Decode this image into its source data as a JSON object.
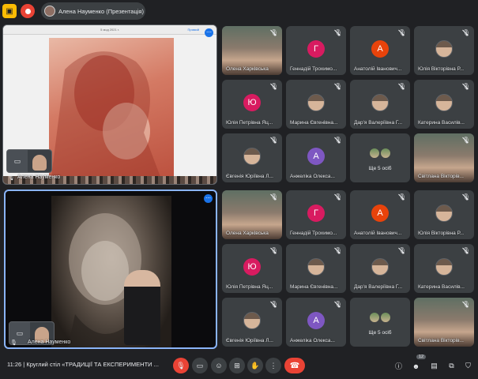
{
  "topbar": {
    "presenter_label": "Алена Науменко (Презентація)"
  },
  "presentation_top": {
    "doc_title": "5 мод 2021 г.",
    "doc_control": "Прямий",
    "self_label": "Алена Науменко"
  },
  "presentation_bottom": {
    "self_label": "Алена Науменко"
  },
  "tiles": [
    {
      "name": "Олена Харківська",
      "type": "video"
    },
    {
      "name": "Геннадій Трохимо...",
      "type": "letter",
      "letter": "Г",
      "color": "#d81b60"
    },
    {
      "name": "Анатолій Іванович...",
      "type": "letter",
      "letter": "А",
      "color": "#e8430b"
    },
    {
      "name": "Юлія Вікторівна Р...",
      "type": "photo"
    },
    {
      "name": "Юлія Петрівна Яц...",
      "type": "letter",
      "letter": "Ю",
      "color": "#d81b60"
    },
    {
      "name": "Марина Євгенівна...",
      "type": "photo"
    },
    {
      "name": "Дар'я Валеріївна Г...",
      "type": "photo"
    },
    {
      "name": "Катерина Василів...",
      "type": "photo"
    },
    {
      "name": "Євгенія Юріївна Л...",
      "type": "photo"
    },
    {
      "name": "Анжеліка Олекса...",
      "type": "letter",
      "letter": "А",
      "color": "#7e57c2"
    },
    {
      "name": "Ще 5 осіб",
      "type": "more"
    },
    {
      "name": "Світлана Вікторів...",
      "type": "video"
    }
  ],
  "bottombar": {
    "time_title": "11:26  |  Круглий стіл «ТРАДИЦІЇ ТА ЕКСПЕРИМЕНТИ ...",
    "participants_count": "12"
  }
}
